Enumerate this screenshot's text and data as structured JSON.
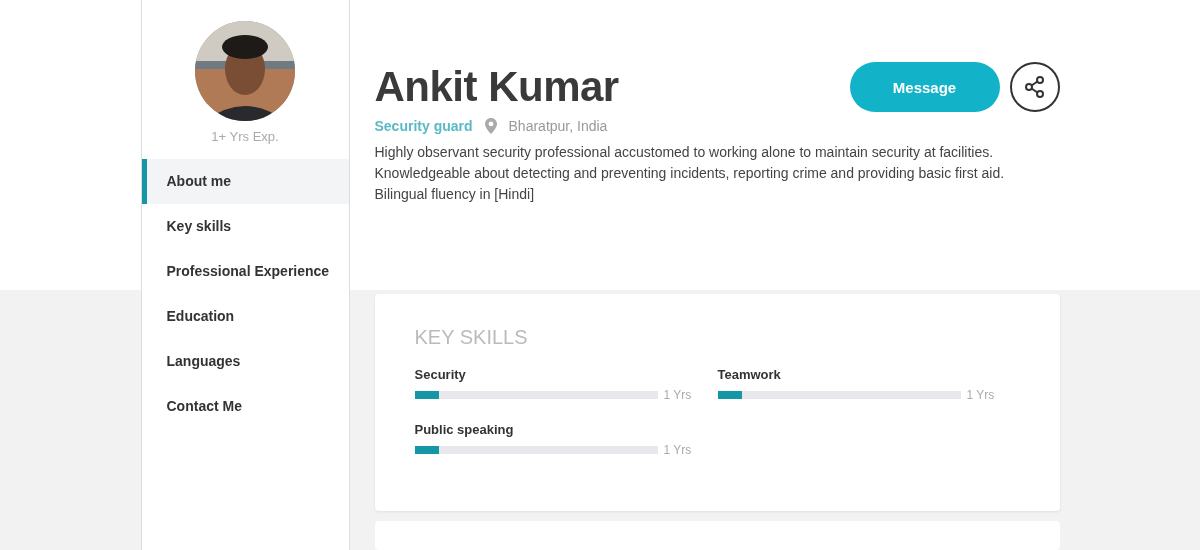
{
  "profile": {
    "experience": "1+ Yrs Exp.",
    "name": "Ankit Kumar",
    "role": "Security guard",
    "location": "Bharatpur, India",
    "summary": "Highly observant security professional accustomed to working alone to maintain security at facilities. Knowledgeable about detecting and preventing incidents, reporting crime and providing basic first aid. Bilingual fluency in [Hindi]"
  },
  "actions": {
    "message": "Message"
  },
  "sidebar": {
    "items": [
      {
        "label": "About me",
        "selected": true
      },
      {
        "label": "Key skills",
        "selected": false
      },
      {
        "label": "Professional Experience",
        "selected": false
      },
      {
        "label": "Education",
        "selected": false
      },
      {
        "label": "Languages",
        "selected": false
      },
      {
        "label": "Contact Me",
        "selected": false
      }
    ]
  },
  "key_skills": {
    "title": "KEY SKILLS",
    "skills": [
      {
        "name": "Security",
        "level": 0.1,
        "reading": "1 Yrs"
      },
      {
        "name": "Teamwork",
        "level": 0.1,
        "reading": "1 Yrs"
      },
      {
        "name": "Public speaking",
        "level": 0.1,
        "reading": "1 Yrs"
      }
    ]
  }
}
